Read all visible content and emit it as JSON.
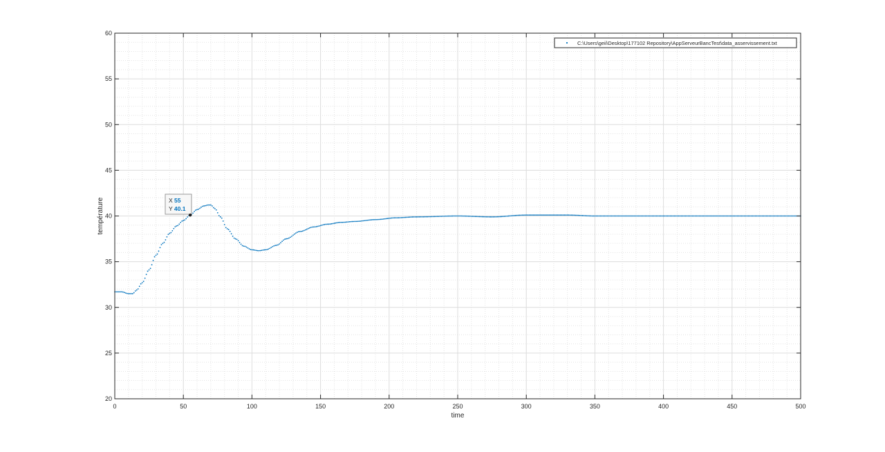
{
  "chart_data": {
    "type": "scatter",
    "title": "",
    "xlabel": "time",
    "ylabel": "température",
    "xlim": [
      0,
      500
    ],
    "ylim": [
      20,
      60
    ],
    "xticks": [
      0,
      50,
      100,
      150,
      200,
      250,
      300,
      350,
      400,
      450,
      500
    ],
    "yticks": [
      20,
      25,
      30,
      35,
      40,
      45,
      50,
      55,
      60
    ],
    "grid": true,
    "minor_grid": true,
    "legend": {
      "position": "top-right",
      "entries": [
        "C:\\Users\\geii\\Desktop\\177102 Repository\\AppServeurBancTest\\data_asservissement.txt"
      ]
    },
    "series": [
      {
        "name": "C:\\Users\\geii\\Desktop\\177102 Repository\\AppServeurBancTest\\data_asservissement.txt",
        "color": "#0072BD",
        "marker": "point",
        "x_start": 0,
        "x_step": 1,
        "x_end": 500,
        "key_points": [
          [
            0,
            31.7
          ],
          [
            5,
            31.7
          ],
          [
            10,
            31.5
          ],
          [
            13,
            31.5
          ],
          [
            16,
            31.9
          ],
          [
            20,
            32.7
          ],
          [
            25,
            34.1
          ],
          [
            30,
            35.7
          ],
          [
            35,
            37.0
          ],
          [
            40,
            38.1
          ],
          [
            45,
            38.9
          ],
          [
            50,
            39.5
          ],
          [
            55,
            40.1
          ],
          [
            60,
            40.7
          ],
          [
            65,
            41.1
          ],
          [
            68,
            41.2
          ],
          [
            70,
            41.2
          ],
          [
            73,
            40.8
          ],
          [
            77,
            39.9
          ],
          [
            82,
            38.6
          ],
          [
            88,
            37.5
          ],
          [
            94,
            36.7
          ],
          [
            100,
            36.3
          ],
          [
            105,
            36.2
          ],
          [
            110,
            36.3
          ],
          [
            118,
            36.8
          ],
          [
            125,
            37.5
          ],
          [
            135,
            38.3
          ],
          [
            145,
            38.8
          ],
          [
            155,
            39.1
          ],
          [
            165,
            39.3
          ],
          [
            175,
            39.4
          ],
          [
            190,
            39.6
          ],
          [
            205,
            39.8
          ],
          [
            220,
            39.9
          ],
          [
            250,
            40.0
          ],
          [
            275,
            39.9
          ],
          [
            300,
            40.1
          ],
          [
            330,
            40.1
          ],
          [
            350,
            40.0
          ],
          [
            400,
            40.0
          ],
          [
            450,
            40.0
          ],
          [
            500,
            40.0
          ]
        ]
      }
    ],
    "datatip": {
      "x_label": "X",
      "x_value": "55",
      "y_label": "Y",
      "y_value": "40.1",
      "point": [
        55,
        40.1
      ]
    }
  }
}
